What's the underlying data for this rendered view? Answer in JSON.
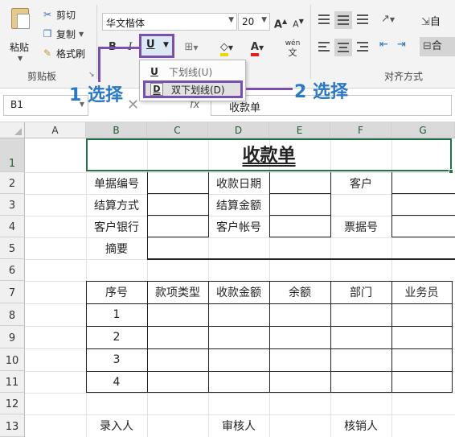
{
  "ribbon": {
    "clipboard": {
      "paste_label": "粘贴",
      "cut_label": "剪切",
      "copy_label": "复制",
      "format_painter_label": "格式刷",
      "group_label": "剪贴板"
    },
    "font": {
      "font_name": "华文楷体",
      "font_size": "20",
      "grow_label": "A",
      "shrink_label": "A",
      "bold_label": "B",
      "italic_label": "I",
      "underline_label": "U",
      "wen_label": "wén"
    },
    "alignment": {
      "group_label": "对齐方式",
      "wrap_label": "自",
      "merge_label": "合"
    }
  },
  "underline_menu": {
    "items": [
      {
        "icon": "U",
        "label": "下划线(U)"
      },
      {
        "icon": "D",
        "label": "双下划线(D)"
      }
    ]
  },
  "callouts": {
    "step1": "1 选择",
    "step2": "2 选择"
  },
  "formula_bar": {
    "name_box": "B1",
    "content": "收款单"
  },
  "sheet": {
    "columns": [
      "A",
      "B",
      "C",
      "D",
      "E",
      "F",
      "G"
    ],
    "rows": [
      "1",
      "2",
      "3",
      "4",
      "5",
      "6",
      "7",
      "8",
      "9",
      "10",
      "11",
      "12",
      "13"
    ],
    "title": "收款单",
    "info_rows": [
      {
        "l1": "单据编号",
        "l2": "收款日期",
        "l3": "客户"
      },
      {
        "l1": "结算方式",
        "l2": "结算金额",
        "l3": ""
      },
      {
        "l1": "客户银行",
        "l2": "客户帐号",
        "l3": "票据号"
      }
    ],
    "summary_label": "摘要",
    "table_headers": [
      "序号",
      "款项类型",
      "收款金额",
      "余额",
      "部门",
      "业务员"
    ],
    "table_rows": [
      "1",
      "2",
      "3",
      "4"
    ],
    "footer": [
      "录入人",
      "审核人",
      "核销人"
    ]
  },
  "colors": {
    "accent_purple": "#7a4fb0",
    "callout_blue": "#2a78c8",
    "selection_green": "#217346"
  }
}
